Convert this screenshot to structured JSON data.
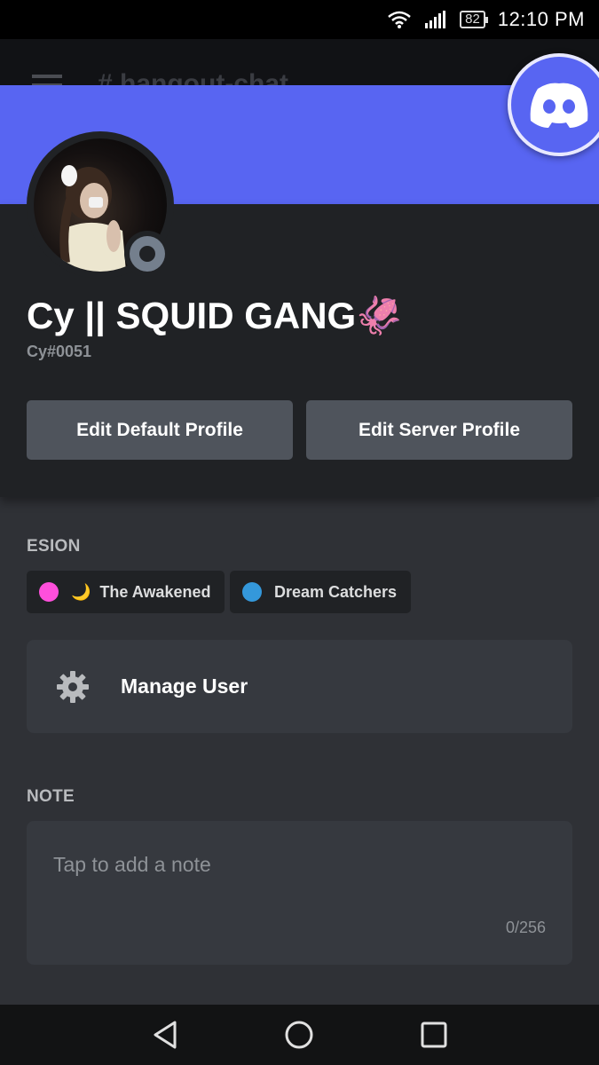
{
  "status_bar": {
    "battery": "82",
    "time": "12:10 PM"
  },
  "background_channel": {
    "hamburger_icon": "menu-icon",
    "channel_name": "# hangout-chat"
  },
  "profile": {
    "display_name": "Cy || SQUID GANG",
    "display_emoji": "🦑",
    "username_tag": "Cy#0051",
    "status": "offline",
    "banner_color": "#5865f2"
  },
  "buttons": {
    "edit_default": "Edit Default Profile",
    "edit_server": "Edit Server Profile"
  },
  "roles_section": {
    "title": "ESION",
    "roles": [
      {
        "name": "The Awakened",
        "color": "#ff4fdc",
        "emoji": "🌙"
      },
      {
        "name": "Dream Catchers",
        "color": "#3498db"
      }
    ]
  },
  "manage_user": {
    "label": "Manage User",
    "icon": "gear-icon"
  },
  "note_section": {
    "title": "NOTE",
    "placeholder": "Tap to add a note",
    "counter": "0/256"
  },
  "nav": {
    "back": "back-icon",
    "home": "home-icon",
    "recents": "recents-icon"
  }
}
